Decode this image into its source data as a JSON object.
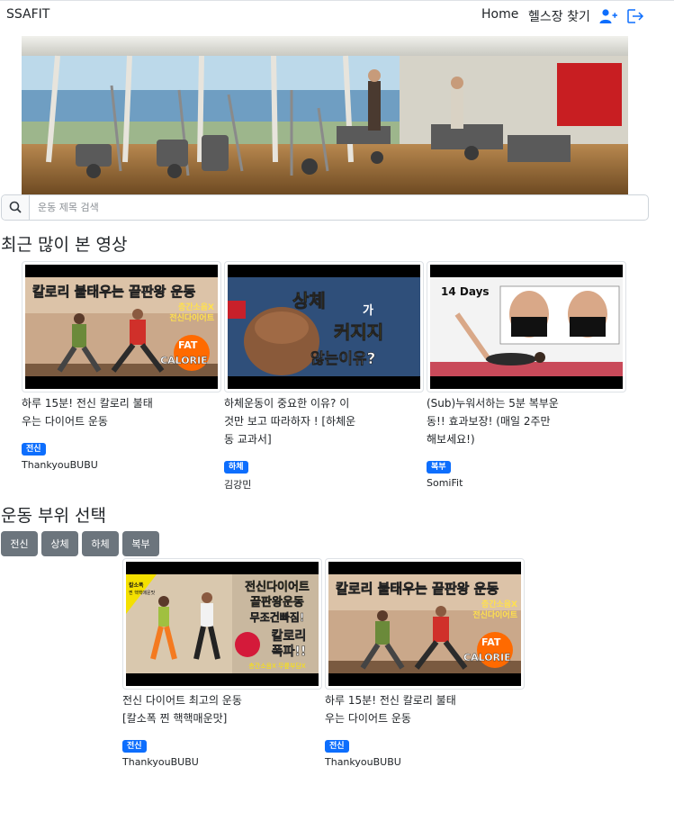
{
  "nav": {
    "brand": "SSAFIT",
    "home": "Home",
    "find_gym": "헬스장 찾기",
    "icons": [
      "person-plus-icon",
      "logout-icon"
    ],
    "accent": "#0d6efd"
  },
  "search": {
    "placeholder": "운동 제목 검색"
  },
  "popular": {
    "title": "최근 많이 본 영상",
    "videos": [
      {
        "title": "하루 15분! 전신 칼로리 불태우는 다이어트 운동",
        "badge": "전신",
        "channel": "ThankyouBUBU",
        "thumb": {
          "top": "칼로리 불태우는 끝판왕 운동",
          "side": [
            "층간소음X",
            "전신다이어트"
          ],
          "label": [
            "FAT",
            "CALORIE"
          ]
        }
      },
      {
        "title": "하체운동이 중요한 이유? 이것만 보고 따라하자 ! [하체운동 교과서]",
        "badge": "하체",
        "channel": "김강민",
        "thumb": {
          "label": [
            "상체",
            "가",
            "커지지",
            "않는이유?"
          ]
        }
      },
      {
        "title": "(Sub)누워서하는 5분 복부운동!! 효과보장! (매일 2주만 해보세요!)",
        "badge": "복부",
        "channel": "SomiFit",
        "thumb": {
          "label": [
            "14 Days"
          ]
        }
      }
    ]
  },
  "parts": {
    "title": "운동 부위 선택",
    "buttons": [
      "전신",
      "상체",
      "하체",
      "복부"
    ],
    "videos": [
      {
        "title": "전신 다이어트 최고의 운동 [칼소폭 찐 핵핵매운맛]",
        "badge": "전신",
        "channel": "ThankyouBUBU",
        "thumb": {
          "label": [
            "전신다이어트",
            "끝판왕운동",
            "무조건빠짐!",
            "칼로리",
            "폭파!!",
            "층간소음X 무릎부담X"
          ],
          "corner": [
            "칼소폭",
            "찐 핵핵매운맛"
          ]
        }
      },
      {
        "title": "하루 15분! 전신 칼로리 불태우는 다이어트 운동",
        "badge": "전신",
        "channel": "ThankyouBUBU",
        "thumb": {
          "top": "칼로리 불태우는 끝판왕 운동",
          "side": [
            "층간소음X",
            "전신다이어트"
          ],
          "label": [
            "FAT",
            "CALORIE"
          ]
        }
      }
    ]
  },
  "colors": {
    "badge": "#0d6efd",
    "part_button": "#6c757d",
    "border": "#dee2e6"
  }
}
